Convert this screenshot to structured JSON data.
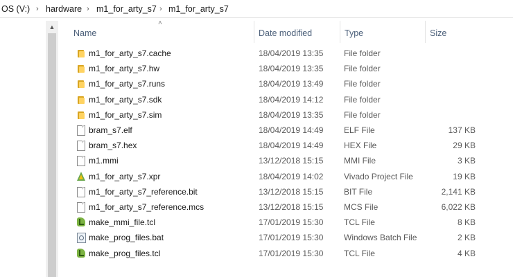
{
  "breadcrumb": [
    "OS (V:)",
    "hardware",
    "m1_for_arty_s7",
    "m1_for_arty_s7"
  ],
  "columns": {
    "name": "Name",
    "date": "Date modified",
    "type": "Type",
    "size": "Size"
  },
  "files": [
    {
      "name": "m1_for_arty_s7.cache",
      "date": "18/04/2019 13:35",
      "type": "File folder",
      "size": "",
      "icon": "folder-icon"
    },
    {
      "name": "m1_for_arty_s7.hw",
      "date": "18/04/2019 13:35",
      "type": "File folder",
      "size": "",
      "icon": "folder-icon"
    },
    {
      "name": "m1_for_arty_s7.runs",
      "date": "18/04/2019 13:49",
      "type": "File folder",
      "size": "",
      "icon": "folder-icon"
    },
    {
      "name": "m1_for_arty_s7.sdk",
      "date": "18/04/2019 14:12",
      "type": "File folder",
      "size": "",
      "icon": "folder-icon"
    },
    {
      "name": "m1_for_arty_s7.sim",
      "date": "18/04/2019 13:35",
      "type": "File folder",
      "size": "",
      "icon": "folder-icon"
    },
    {
      "name": "bram_s7.elf",
      "date": "18/04/2019 14:49",
      "type": "ELF File",
      "size": "137 KB",
      "icon": "file-icon"
    },
    {
      "name": "bram_s7.hex",
      "date": "18/04/2019 14:49",
      "type": "HEX File",
      "size": "29 KB",
      "icon": "file-icon"
    },
    {
      "name": "m1.mmi",
      "date": "13/12/2018 15:15",
      "type": "MMI File",
      "size": "3 KB",
      "icon": "file-icon"
    },
    {
      "name": "m1_for_arty_s7.xpr",
      "date": "18/04/2019 14:02",
      "type": "Vivado Project File",
      "size": "19 KB",
      "icon": "vivado-project-icon"
    },
    {
      "name": "m1_for_arty_s7_reference.bit",
      "date": "13/12/2018 15:15",
      "type": "BIT File",
      "size": "2,141 KB",
      "icon": "file-icon"
    },
    {
      "name": "m1_for_arty_s7_reference.mcs",
      "date": "13/12/2018 15:15",
      "type": "MCS File",
      "size": "6,022 KB",
      "icon": "file-icon"
    },
    {
      "name": "make_mmi_file.tcl",
      "date": "17/01/2019 15:30",
      "type": "TCL File",
      "size": "8 KB",
      "icon": "tcl-script-icon"
    },
    {
      "name": "make_prog_files.bat",
      "date": "17/01/2019 15:30",
      "type": "Windows Batch File",
      "size": "2 KB",
      "icon": "batch-file-icon"
    },
    {
      "name": "make_prog_files.tcl",
      "date": "17/01/2019 15:30",
      "type": "TCL File",
      "size": "4 KB",
      "icon": "tcl-script-icon"
    }
  ],
  "colors": {
    "folder": "#ffd361",
    "header_text": "#4c607a",
    "meta_text": "#5a5a5a",
    "tcl": "#7cb342"
  }
}
